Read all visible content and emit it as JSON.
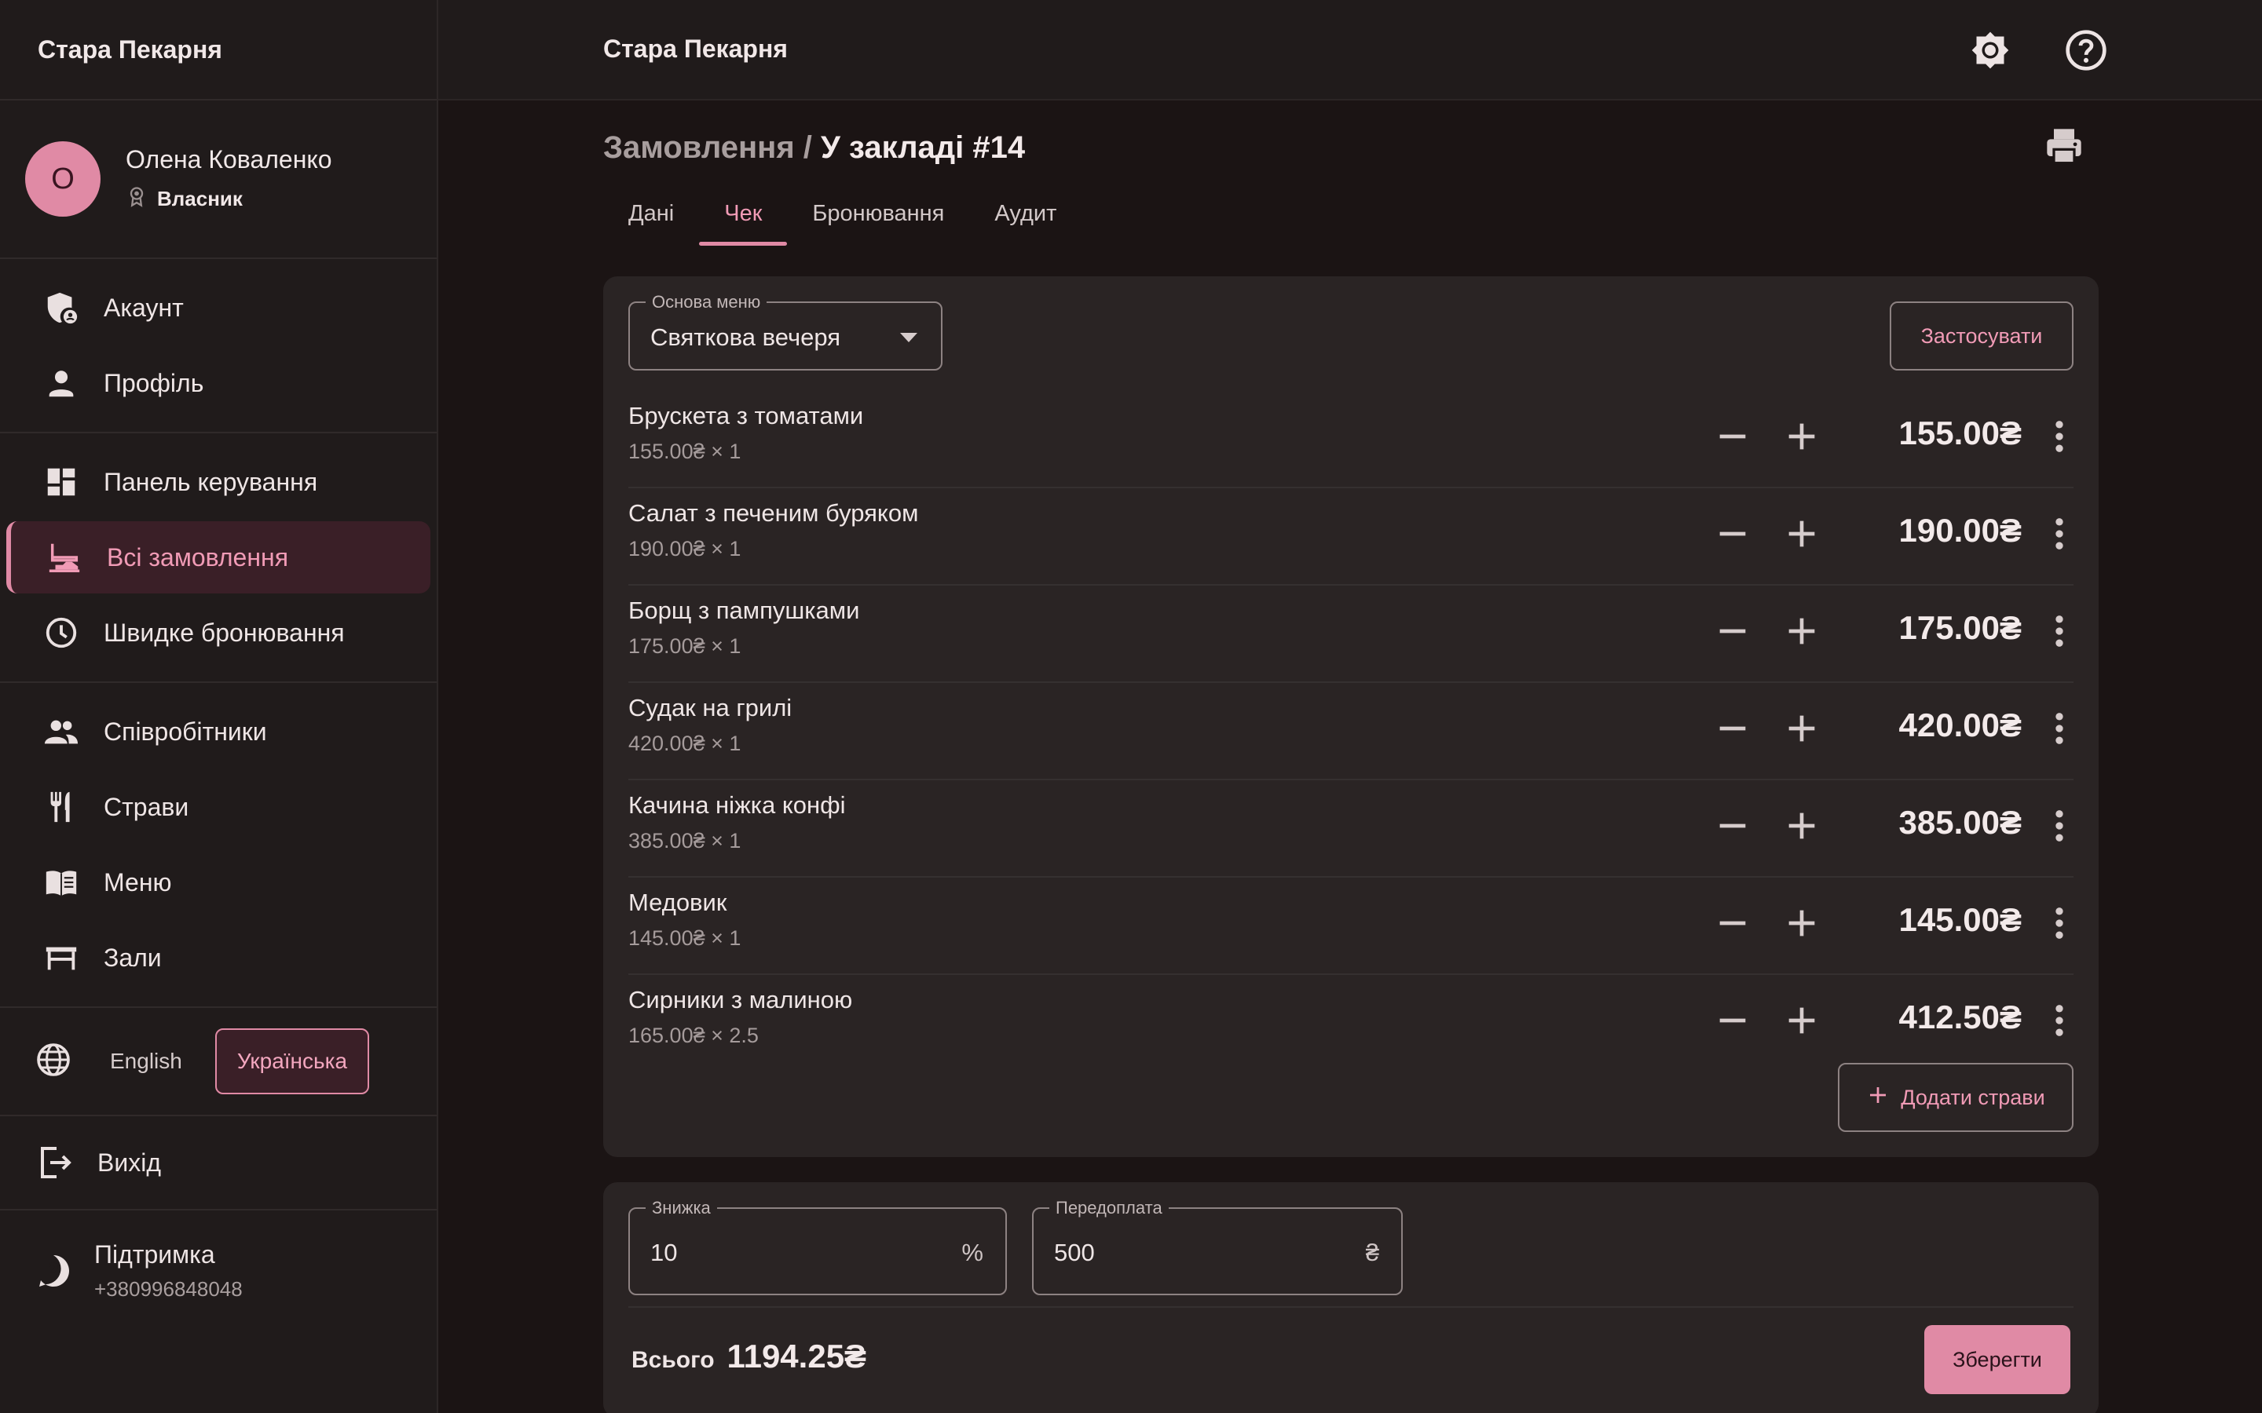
{
  "app": {
    "name": "Стара Пекарня"
  },
  "user": {
    "initial": "О",
    "name": "Олена Коваленко",
    "role": "Власник"
  },
  "sidebar": {
    "account": [
      {
        "label": "Акаунт",
        "icon": "shield-account-icon"
      },
      {
        "label": "Профіль",
        "icon": "person-icon"
      }
    ],
    "main": [
      {
        "label": "Панель керування",
        "icon": "dashboard-icon"
      },
      {
        "label": "Всі замовлення",
        "icon": "room-service-icon",
        "active": true
      },
      {
        "label": "Швидке бронювання",
        "icon": "clock-icon"
      }
    ],
    "manage": [
      {
        "label": "Співробітники",
        "icon": "people-icon"
      },
      {
        "label": "Страви",
        "icon": "restaurant-icon"
      },
      {
        "label": "Меню",
        "icon": "menu-book-icon"
      },
      {
        "label": "Зали",
        "icon": "table-icon"
      }
    ],
    "languages": [
      "English",
      "Українська"
    ],
    "selected_language": "Українська",
    "logout": "Вихід",
    "support": {
      "title": "Підтримка",
      "phone": "+380996848048"
    }
  },
  "header": {
    "title": "Стара Пекарня"
  },
  "breadcrumb": {
    "parent": "Замовлення",
    "separator": "/",
    "current": "У закладі #14"
  },
  "tabs": [
    "Дані",
    "Чек",
    "Бронювання",
    "Аудит"
  ],
  "active_tab": "Чек",
  "receipt": {
    "menu_base_label": "Основа меню",
    "menu_base_value": "Святкова вечеря",
    "apply_label": "Застосувати",
    "add_label": "Додати страви",
    "items": [
      {
        "name": "Брускета з томатами",
        "sub": "155.00₴ × 1",
        "price": "155.00₴"
      },
      {
        "name": "Салат з печеним буряком",
        "sub": "190.00₴ × 1",
        "price": "190.00₴"
      },
      {
        "name": "Борщ з пампушками",
        "sub": "175.00₴ × 1",
        "price": "175.00₴"
      },
      {
        "name": "Судак на грилі",
        "sub": "420.00₴ × 1",
        "price": "420.00₴"
      },
      {
        "name": "Качина ніжка конфі",
        "sub": "385.00₴ × 1",
        "price": "385.00₴"
      },
      {
        "name": "Медовик",
        "sub": "145.00₴ × 1",
        "price": "145.00₴"
      },
      {
        "name": "Сирники з малиною",
        "sub": "165.00₴ × 2.5",
        "price": "412.50₴"
      }
    ]
  },
  "payment": {
    "discount_label": "Знижка",
    "discount_value": "10",
    "discount_suffix": "%",
    "prepay_label": "Передоплата",
    "prepay_value": "500",
    "prepay_suffix": "₴",
    "total_label": "Всього",
    "total_value": "1194.25₴",
    "save_label": "Зберегти"
  },
  "colors": {
    "accent": "#e08aa5",
    "background": "#1b1414",
    "surface": "#2a2424"
  }
}
